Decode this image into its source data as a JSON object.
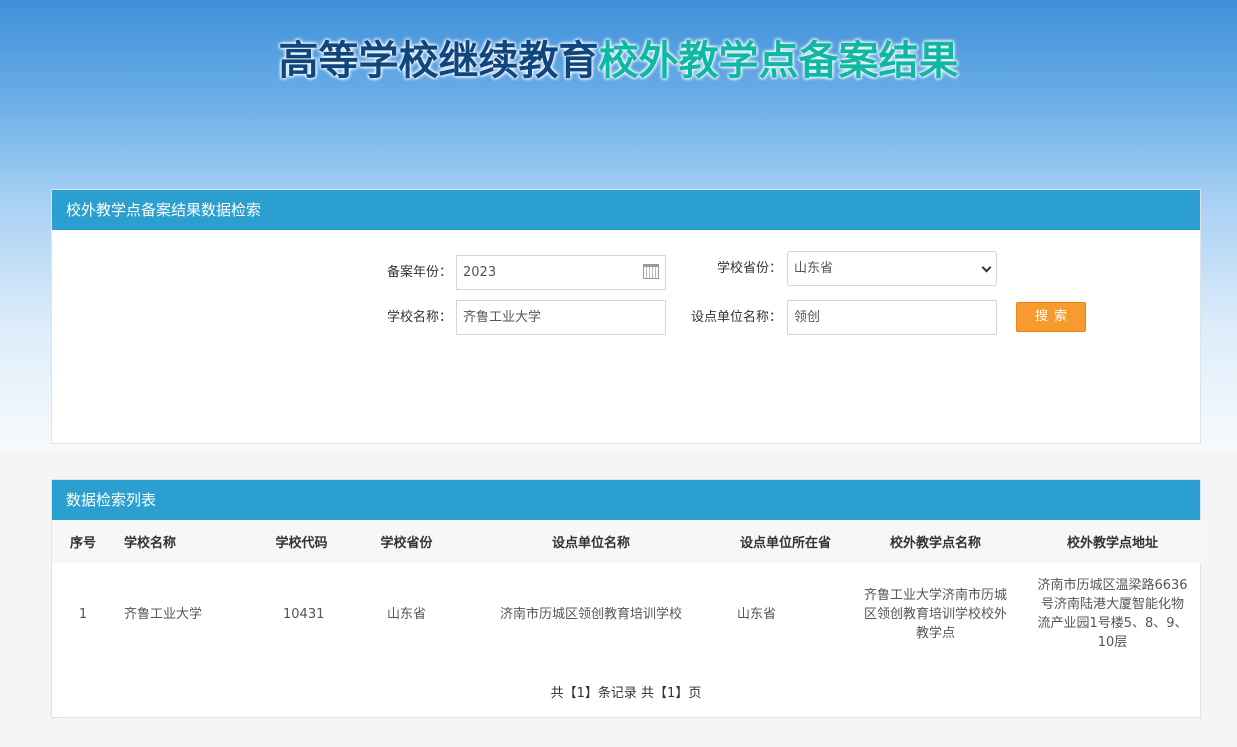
{
  "hero": {
    "title_part1": "高等学校继续教育",
    "title_part2": "校外教学点备案结果"
  },
  "search": {
    "panel_title": "校外教学点备案结果数据检索",
    "year_label": "备案年份：",
    "year_value": "2023",
    "province_label": "学校省份：",
    "province_value": "山东省",
    "school_label": "学校名称：",
    "school_value": "齐鲁工业大学",
    "unit_label": "设点单位名称：",
    "unit_value": "领创",
    "search_button": "搜索"
  },
  "list": {
    "panel_title": "数据检索列表",
    "headers": [
      "序号",
      "学校名称",
      "学校代码",
      "学校省份",
      "设点单位名称",
      "设点单位所在省",
      "校外教学点名称",
      "校外教学点地址"
    ],
    "rows": [
      [
        "1",
        "齐鲁工业大学",
        "10431",
        "山东省",
        "济南市历城区领创教育培训学校",
        "山东省",
        "齐鲁工业大学济南市历城区领创教育培训学校校外教学点",
        "济南市历城区温梁路6636号济南陆港大厦智能化物流产业园1号楼5、8、9、10层"
      ]
    ],
    "pager": "共【1】条记录 共【1】页"
  },
  "colors": {
    "header_blue": "#2b9fd0",
    "button_orange": "#f89b2e",
    "title_dark": "#10467e",
    "title_teal": "#10b7a3"
  },
  "icons": {
    "calendar": "calendar-icon",
    "dropdown": "chevron-down-icon"
  }
}
